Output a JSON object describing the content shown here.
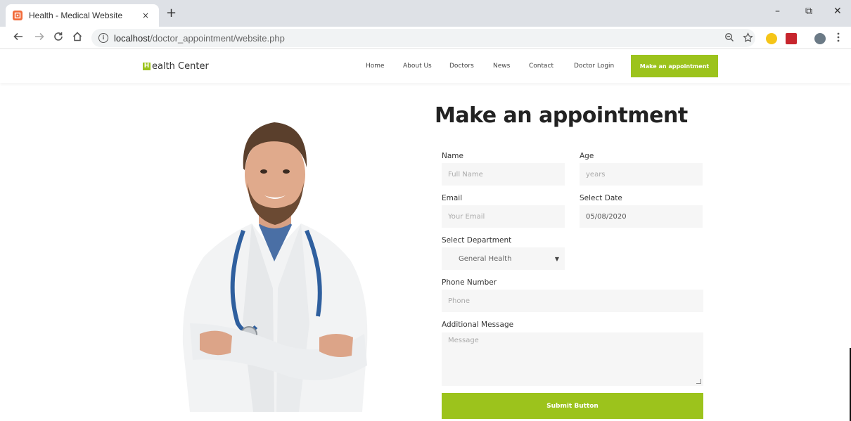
{
  "browser": {
    "tab_title": "Health - Medical Website",
    "tab_close": "×",
    "new_tab": "+",
    "url_host": "localhost",
    "url_path": "/doctor_appointment/website.php",
    "minimize": "–",
    "restore": "⧉",
    "close": "✕"
  },
  "header": {
    "logo_mark": "H",
    "logo_text": "ealth Center",
    "nav": [
      "Home",
      "About Us",
      "Doctors",
      "News",
      "Contact",
      "Doctor Login"
    ],
    "cta_label": "Make an appointment"
  },
  "form": {
    "title": "Make an appointment",
    "name_label": "Name",
    "name_placeholder": "Full Name",
    "age_label": "Age",
    "age_placeholder": "years",
    "email_label": "Email",
    "email_placeholder": "Your Email",
    "date_label": "Select Date",
    "date_value": "05/08/2020",
    "department_label": "Select Department",
    "department_value": "General Health",
    "phone_label": "Phone Number",
    "phone_placeholder": "Phone",
    "message_label": "Additional Message",
    "message_placeholder": "Message",
    "submit_label": "Submit Button"
  },
  "colors": {
    "accent": "#9cc31c",
    "field_bg": "#f6f6f6",
    "chrome_bg": "#dee1e6"
  }
}
